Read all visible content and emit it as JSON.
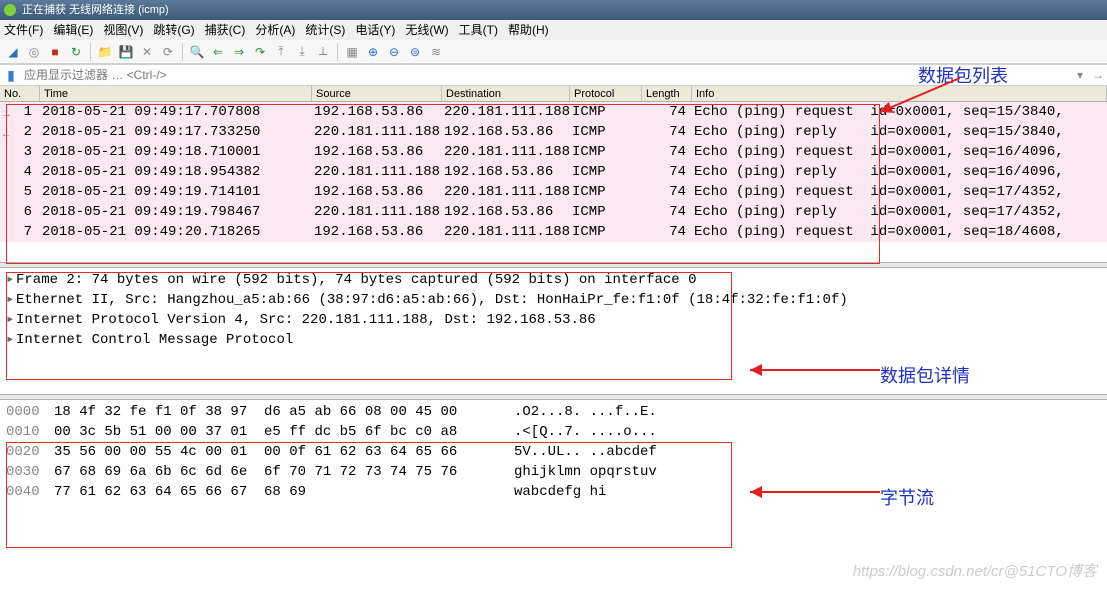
{
  "title": "正在捕获 无线网络连接 (icmp)",
  "menu": [
    "文件(F)",
    "编辑(E)",
    "视图(V)",
    "跳转(G)",
    "捕获(C)",
    "分析(A)",
    "统计(S)",
    "电话(Y)",
    "无线(W)",
    "工具(T)",
    "帮助(H)"
  ],
  "filter_placeholder": "应用显示过滤器 … <Ctrl-/>",
  "columns": {
    "no": "No.",
    "time": "Time",
    "src": "Source",
    "dst": "Destination",
    "proto": "Protocol",
    "len": "Length",
    "info": "Info"
  },
  "packets": [
    {
      "no": "1",
      "time": "2018-05-21 09:49:17.707808",
      "src": "192.168.53.86",
      "dst": "220.181.111.188",
      "proto": "ICMP",
      "len": "74",
      "info": "Echo (ping) request  id=0x0001, seq=15/3840,",
      "pink": true,
      "mark": "→"
    },
    {
      "no": "2",
      "time": "2018-05-21 09:49:17.733250",
      "src": "220.181.111.188",
      "dst": "192.168.53.86",
      "proto": "ICMP",
      "len": "74",
      "info": "Echo (ping) reply    id=0x0001, seq=15/3840,",
      "pink": true,
      "mark": "←"
    },
    {
      "no": "3",
      "time": "2018-05-21 09:49:18.710001",
      "src": "192.168.53.86",
      "dst": "220.181.111.188",
      "proto": "ICMP",
      "len": "74",
      "info": "Echo (ping) request  id=0x0001, seq=16/4096,",
      "pink": true
    },
    {
      "no": "4",
      "time": "2018-05-21 09:49:18.954382",
      "src": "220.181.111.188",
      "dst": "192.168.53.86",
      "proto": "ICMP",
      "len": "74",
      "info": "Echo (ping) reply    id=0x0001, seq=16/4096,",
      "pink": true
    },
    {
      "no": "5",
      "time": "2018-05-21 09:49:19.714101",
      "src": "192.168.53.86",
      "dst": "220.181.111.188",
      "proto": "ICMP",
      "len": "74",
      "info": "Echo (ping) request  id=0x0001, seq=17/4352,",
      "pink": true
    },
    {
      "no": "6",
      "time": "2018-05-21 09:49:19.798467",
      "src": "220.181.111.188",
      "dst": "192.168.53.86",
      "proto": "ICMP",
      "len": "74",
      "info": "Echo (ping) reply    id=0x0001, seq=17/4352,",
      "pink": true
    },
    {
      "no": "7",
      "time": "2018-05-21 09:49:20.718265",
      "src": "192.168.53.86",
      "dst": "220.181.111.188",
      "proto": "ICMP",
      "len": "74",
      "info": "Echo (ping) request  id=0x0001, seq=18/4608,",
      "pink": true
    }
  ],
  "details": [
    "Frame 2: 74 bytes on wire (592 bits), 74 bytes captured (592 bits) on interface 0",
    "Ethernet II, Src: Hangzhou_a5:ab:66 (38:97:d6:a5:ab:66), Dst: HonHaiPr_fe:f1:0f (18:4f:32:fe:f1:0f)",
    "Internet Protocol Version 4, Src: 220.181.111.188, Dst: 192.168.53.86",
    "Internet Control Message Protocol"
  ],
  "hex": [
    {
      "off": "0000",
      "b": "18 4f 32 fe f1 0f 38 97  d6 a5 ab 66 08 00 45 00",
      "a": ".O2...8. ...f..E."
    },
    {
      "off": "0010",
      "b": "00 3c 5b 51 00 00 37 01  e5 ff dc b5 6f bc c0 a8",
      "a": ".<[Q..7. ....o..."
    },
    {
      "off": "0020",
      "b": "35 56 00 00 55 4c 00 01  00 0f 61 62 63 64 65 66",
      "a": "5V..UL.. ..abcdef"
    },
    {
      "off": "0030",
      "b": "67 68 69 6a 6b 6c 6d 6e  6f 70 71 72 73 74 75 76",
      "a": "ghijklmn opqrstuv"
    },
    {
      "off": "0040",
      "b": "77 61 62 63 64 65 66 67  68 69",
      "a": "wabcdefg hi"
    }
  ],
  "annotations": {
    "list": "数据包列表",
    "detail": "数据包详情",
    "bytes": "字节流"
  },
  "watermark": "https://blog.csdn.net/cr@51CTO博客"
}
